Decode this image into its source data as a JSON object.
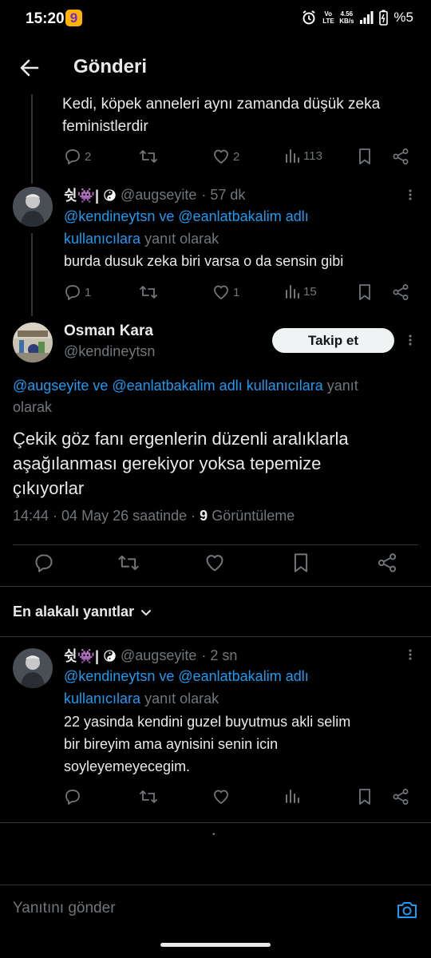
{
  "status_bar": {
    "time": "15:20",
    "app_icon": "9",
    "network_speed_value": "4.56",
    "network_speed_unit": "KB/s",
    "volte": "Vo LTE",
    "battery": "%5"
  },
  "header": {
    "title": "Gönderi"
  },
  "parent_tweet": {
    "text_line1": "Kedi, köpek anneleri aynı zamanda düşük zeka",
    "text_line2": "feministlerdir",
    "replies": "2",
    "likes": "2",
    "views": "113"
  },
  "reply_tweet_1": {
    "display_name": "쉿👾|",
    "handle": "@augseyite",
    "time": "· 57 dk",
    "reply_to_line1": "@kendineytsn ve @eanlatbakalim adlı",
    "reply_to_line2_link": "kullanıcılara",
    "reply_to_line2_suffix": "yanıt olarak",
    "text": "burda dusuk zeka biri varsa o da sensin gibi",
    "replies": "1",
    "likes": "1",
    "views": "15"
  },
  "main_tweet": {
    "display_name": "Osman Kara",
    "handle": "@kendineytsn",
    "follow_label": "Takip et",
    "reply_to_line1_link": "@augseyite ve @eanlatbakalim adlı kullanıcılara",
    "reply_to_line1_suffix": "yanıt",
    "reply_to_line2": "olarak",
    "text_line1": "Çekik göz fanı ergenlerin düzenli aralıklarla",
    "text_line2": "aşağılanması gerekiyor yoksa tepemize",
    "text_line3": "çıkıyorlar",
    "meta_prefix": "14:44 · 04 May 26 saatinde ·",
    "views_count": "9",
    "views_label": "Görüntüleme"
  },
  "sort": {
    "label": "En alakalı yanıtlar"
  },
  "reply_tweet_2": {
    "display_name": "쉿👾|",
    "handle": "@augseyite",
    "time": "· 2 sn",
    "reply_to_line1": "@kendineytsn ve @eanlatbakalim adlı",
    "reply_to_line2_link": "kullanıcılara",
    "reply_to_line2_suffix": "yanıt olarak",
    "text_line1": "22 yasinda kendini guzel buyutmus akli selim",
    "text_line2": "bir bireyim ama aynisini senin icin",
    "text_line3": "soyleyemeyecegim."
  },
  "loading_dot": "•",
  "composer": {
    "placeholder": "Yanıtını gönder"
  },
  "icons": [
    "back-arrow-icon",
    "reply-icon",
    "retweet-icon",
    "like-icon",
    "views-icon",
    "bookmark-icon",
    "share-icon",
    "more-icon",
    "chevron-down-icon",
    "camera-icon"
  ],
  "colors": {
    "background": "#000000",
    "text": "#e7e9ea",
    "muted": "#71767b",
    "link": "#1d9bf0",
    "divider": "#2f3336"
  }
}
